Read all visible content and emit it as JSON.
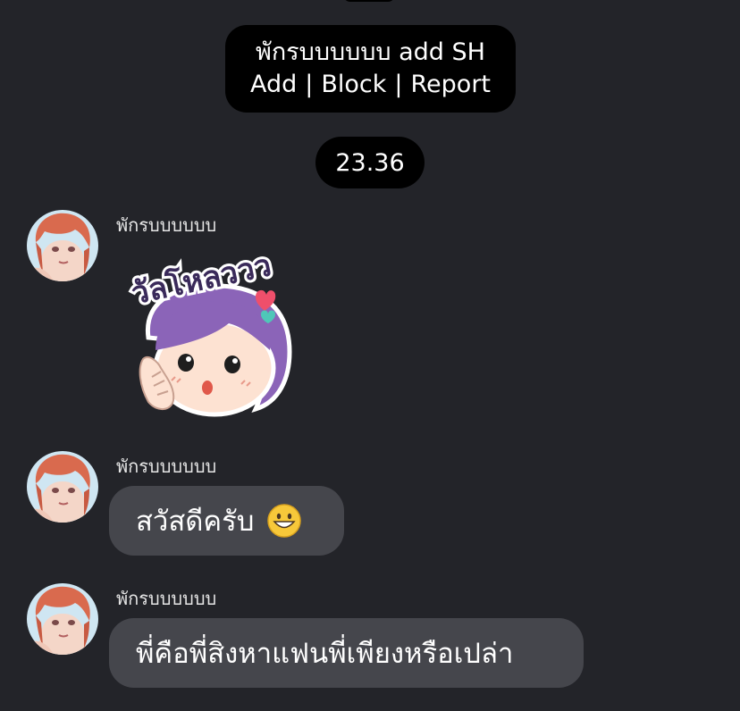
{
  "system_notice": {
    "line1": "พักรบบบบบบ add SH",
    "actions": [
      "Add",
      "Block",
      "Report"
    ],
    "separator": "|"
  },
  "timestamp": "23.36",
  "messages": [
    {
      "sender": "พักรบบบบบบ",
      "type": "sticker",
      "sticker_text": "วัลโหลววว"
    },
    {
      "sender": "พักรบบบบบบ",
      "type": "text",
      "text": "สวัสดีครับ",
      "emoji": "grinning-face"
    },
    {
      "sender": "พักรบบบบบบ",
      "type": "text",
      "text": "พี่คือพี่สิงหาแฟนพี่เพียงหรือเปล่า"
    }
  ],
  "colors": {
    "background": "#232429",
    "bubble": "#45464c",
    "pill": "#000000",
    "text": "#ffffff"
  }
}
